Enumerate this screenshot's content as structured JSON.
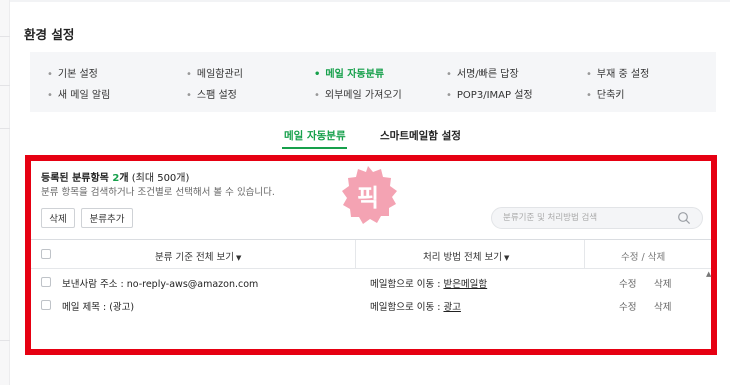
{
  "page": {
    "title": "환경 설정"
  },
  "menu": {
    "items": [
      {
        "label": "기본 설정"
      },
      {
        "label": "메일함관리"
      },
      {
        "label": "메일 자동분류"
      },
      {
        "label": "서명/빠른 답장"
      },
      {
        "label": "부재 중 설정"
      },
      {
        "label": "새 메일 알림"
      },
      {
        "label": "스팸 설정"
      },
      {
        "label": "외부메일 가져오기"
      },
      {
        "label": "POP3/IMAP 설정"
      },
      {
        "label": "단축키"
      }
    ],
    "active_index": 2
  },
  "tabs": [
    {
      "label": "메일 자동분류"
    },
    {
      "label": "스마트메일함 설정"
    }
  ],
  "rules": {
    "count_prefix": "등록된 분류항목 ",
    "count": "2",
    "count_unit": "개",
    "max_text": " (최대 500개)",
    "description": "분류 항목을 검색하거나 조건별로 선택해서 볼 수 있습니다.",
    "delete_label": "삭제",
    "add_label": "분류추가",
    "search_placeholder": "분류기준 및 처리방법 검색"
  },
  "table": {
    "headers": {
      "criteria": "분류 기준 전체 보기",
      "method": "처리 방법 전체 보기",
      "edit_delete": "수정 / 삭제"
    },
    "rows": [
      {
        "criteria": "보낸사람 주소 : no-reply-aws@amazon.com",
        "method_prefix": "메일함으로 이동 : ",
        "method_target": "받은메일함",
        "edit": "수정",
        "delete": "삭제"
      },
      {
        "criteria": "메일 제목 : (광고)",
        "method_prefix": "메일함으로 이동 : ",
        "method_target": "광고",
        "edit": "수정",
        "delete": "삭제"
      }
    ]
  },
  "sticker": {
    "text": "픽"
  },
  "colors": {
    "accent": "#16a04b",
    "highlight_border": "#e60012",
    "sticker": "#f4a3b3"
  }
}
